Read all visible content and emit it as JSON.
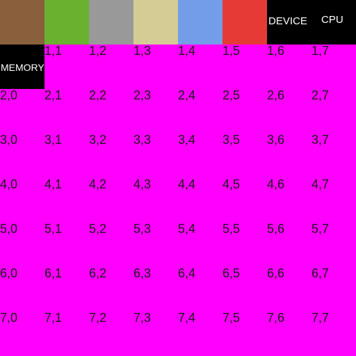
{
  "swatches": [
    {
      "name": "brown",
      "color": "#8a5f3c"
    },
    {
      "name": "green",
      "color": "#6ab12f"
    },
    {
      "name": "gray",
      "color": "#999999"
    },
    {
      "name": "tan",
      "color": "#d4cc94"
    },
    {
      "name": "blue",
      "color": "#739de8"
    },
    {
      "name": "red",
      "color": "#e63b34"
    }
  ],
  "labels": {
    "device": "DEVICE",
    "cpu": "CPU",
    "memory": "MEMORY"
  },
  "background_color": "#ff00ff",
  "rows": [
    [
      "",
      "",
      "",
      "",
      "",
      "",
      "",
      ""
    ],
    [
      "",
      "1,1",
      "1,2",
      "1,3",
      "1,4",
      "1,5",
      "1,6",
      "1,7"
    ],
    [
      "2,0",
      "2,1",
      "2,2",
      "2,3",
      "2,4",
      "2,5",
      "2,6",
      "2,7"
    ],
    [
      "3,0",
      "3,1",
      "3,2",
      "3,3",
      "3,4",
      "3,5",
      "3,6",
      "3,7"
    ],
    [
      "4,0",
      "4,1",
      "4,2",
      "4,3",
      "4,4",
      "4,5",
      "4,6",
      "4,7"
    ],
    [
      "5,0",
      "5,1",
      "5,2",
      "5,3",
      "5,4",
      "5,5",
      "5,6",
      "5,7"
    ],
    [
      "6,0",
      "6,1",
      "6,2",
      "6,3",
      "6,4",
      "6,5",
      "6,6",
      "6,7"
    ],
    [
      "7,0",
      "7,1",
      "7,2",
      "7,3",
      "7,4",
      "7,5",
      "7,6",
      "7,7"
    ]
  ]
}
